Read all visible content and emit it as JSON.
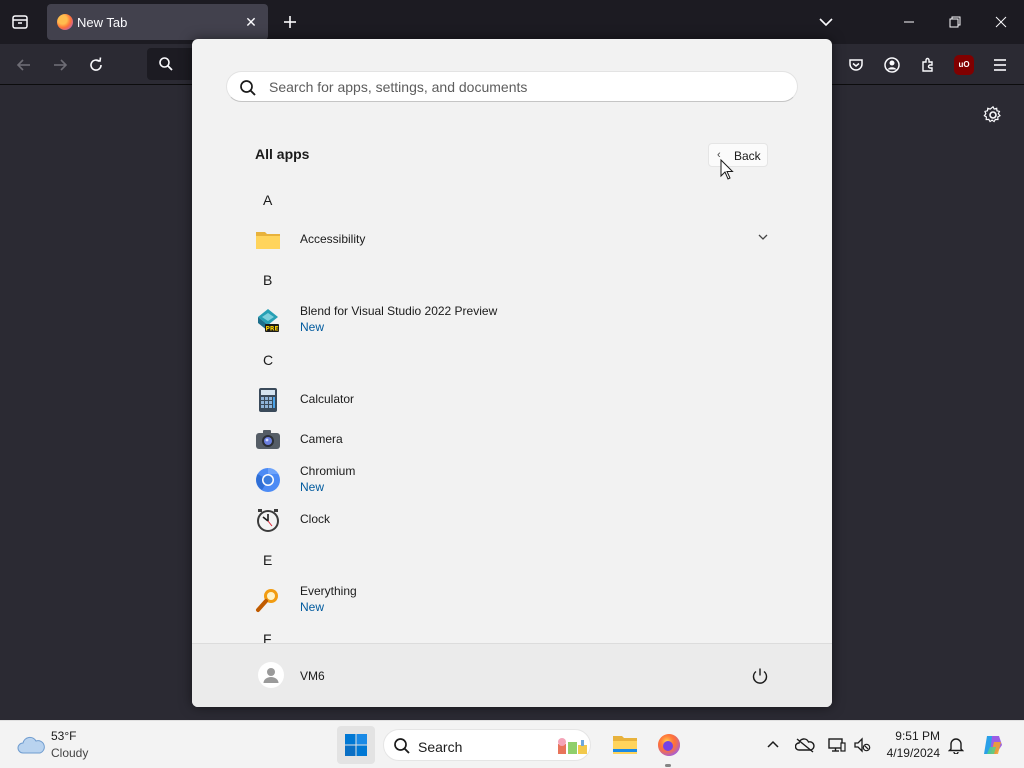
{
  "browser": {
    "tab_title": "New Tab",
    "tab_close_glyph": "✕",
    "ublock_label": "uO"
  },
  "start_menu": {
    "search_placeholder": "Search for apps, settings, and documents",
    "all_apps_title": "All apps",
    "back_label": "Back",
    "back_chevron": "‹",
    "letters": [
      "A",
      "B",
      "C",
      "E",
      "F"
    ],
    "apps": [
      {
        "name": "Accessibility",
        "icon": "folder-icon",
        "expandable": true
      },
      {
        "name": "Blend for Visual Studio 2022 Preview",
        "sub": "New",
        "icon": "blend-preview-icon"
      },
      {
        "name": "Calculator",
        "icon": "calculator-icon"
      },
      {
        "name": "Camera",
        "icon": "camera-icon"
      },
      {
        "name": "Chromium",
        "sub": "New",
        "icon": "chromium-icon"
      },
      {
        "name": "Clock",
        "icon": "clock-icon"
      },
      {
        "name": "Everything",
        "sub": "New",
        "icon": "everything-icon"
      }
    ],
    "user_name": "VM6"
  },
  "taskbar": {
    "weather_temp": "53°F",
    "weather_desc": "Cloudy",
    "search_label": "Search",
    "clock_time": "9:51 PM",
    "clock_date": "4/19/2024"
  },
  "colors": {
    "firefox_dark": "#1c1b22",
    "toolbar": "#2b2a33",
    "start_bg": "#f2f2f2",
    "accent_blue": "#005a9e",
    "windows_blue": "#0078d4"
  }
}
